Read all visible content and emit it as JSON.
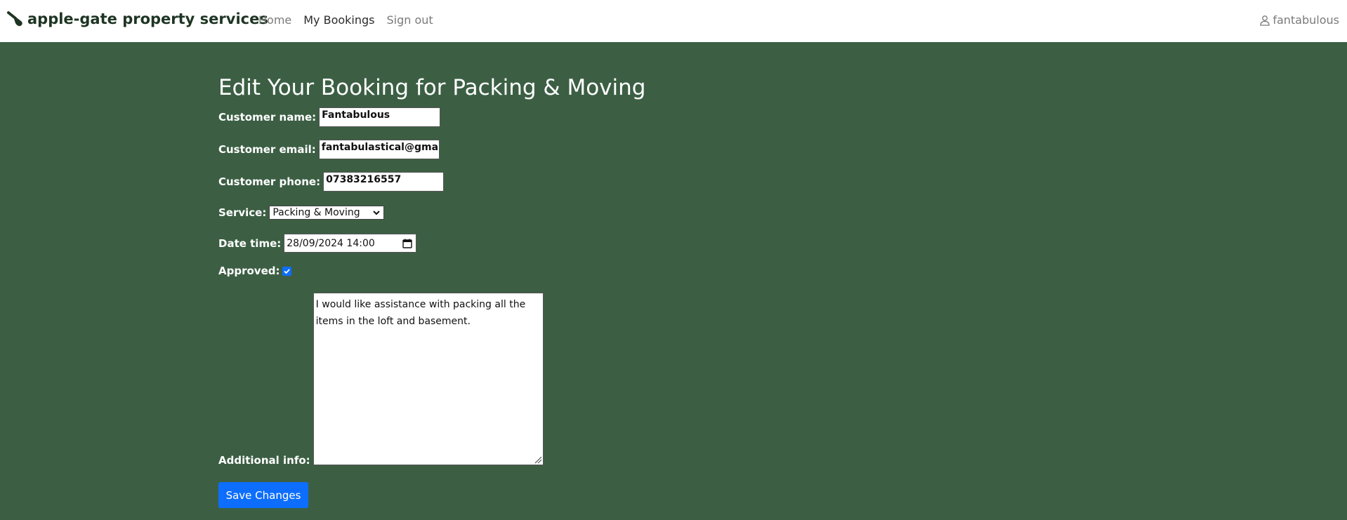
{
  "navbar": {
    "brand": "apple-gate property services",
    "links": [
      {
        "label": "Home",
        "active": false
      },
      {
        "label": "My Bookings",
        "active": true
      },
      {
        "label": "Sign out",
        "active": false
      }
    ],
    "username": "fantabulous"
  },
  "form": {
    "title": "Edit Your Booking for Packing & Moving",
    "customer_name": {
      "label": "Customer name:",
      "value": "Fantabulous"
    },
    "customer_email": {
      "label": "Customer email:",
      "value": "fantabulastical@gmail"
    },
    "customer_phone": {
      "label": "Customer phone:",
      "value": "07383216557"
    },
    "service": {
      "label": "Service:",
      "value": "Packing & Moving"
    },
    "date_time": {
      "label": "Date time:",
      "value": "28/09/2024 14:00"
    },
    "approved": {
      "label": "Approved:",
      "checked": true
    },
    "additional_info": {
      "label": "Additional info:",
      "value": "I would like assistance with packing all the items in the loft and basement."
    },
    "save_label": "Save Changes"
  },
  "colors": {
    "background": "#3c5f44",
    "navbar": "#ffffff",
    "brand_text": "#1e3523",
    "primary": "#0d6efd"
  },
  "icons": {
    "brand": "paintbrush-icon",
    "user": "person-icon",
    "select": "chevron-down-icon",
    "date": "calendar-icon",
    "checkbox": "check-icon",
    "textarea": "resize-grip-icon"
  }
}
